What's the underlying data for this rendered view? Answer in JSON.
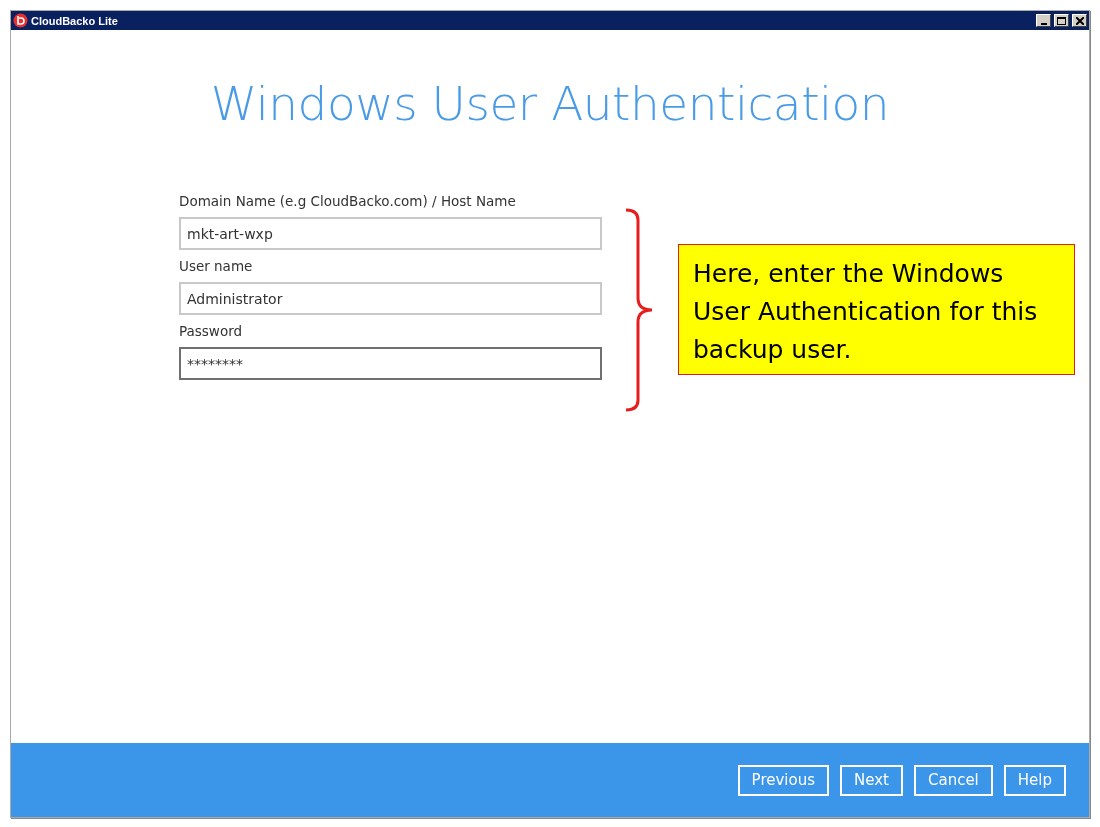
{
  "window": {
    "title": "CloudBacko Lite"
  },
  "heading": "Windows User Authentication",
  "fields": [
    {
      "label": "Domain Name (e.g CloudBacko.com) / Host Name",
      "value": "mkt-art-wxp",
      "focused": false
    },
    {
      "label": "User name",
      "value": "Administrator",
      "focused": false
    },
    {
      "label": "Password",
      "value": "********",
      "focused": true
    }
  ],
  "callout": {
    "text": "Here, enter the Windows User Authentication for this backup user."
  },
  "buttons": [
    "Previous",
    "Next",
    "Cancel",
    "Help"
  ]
}
